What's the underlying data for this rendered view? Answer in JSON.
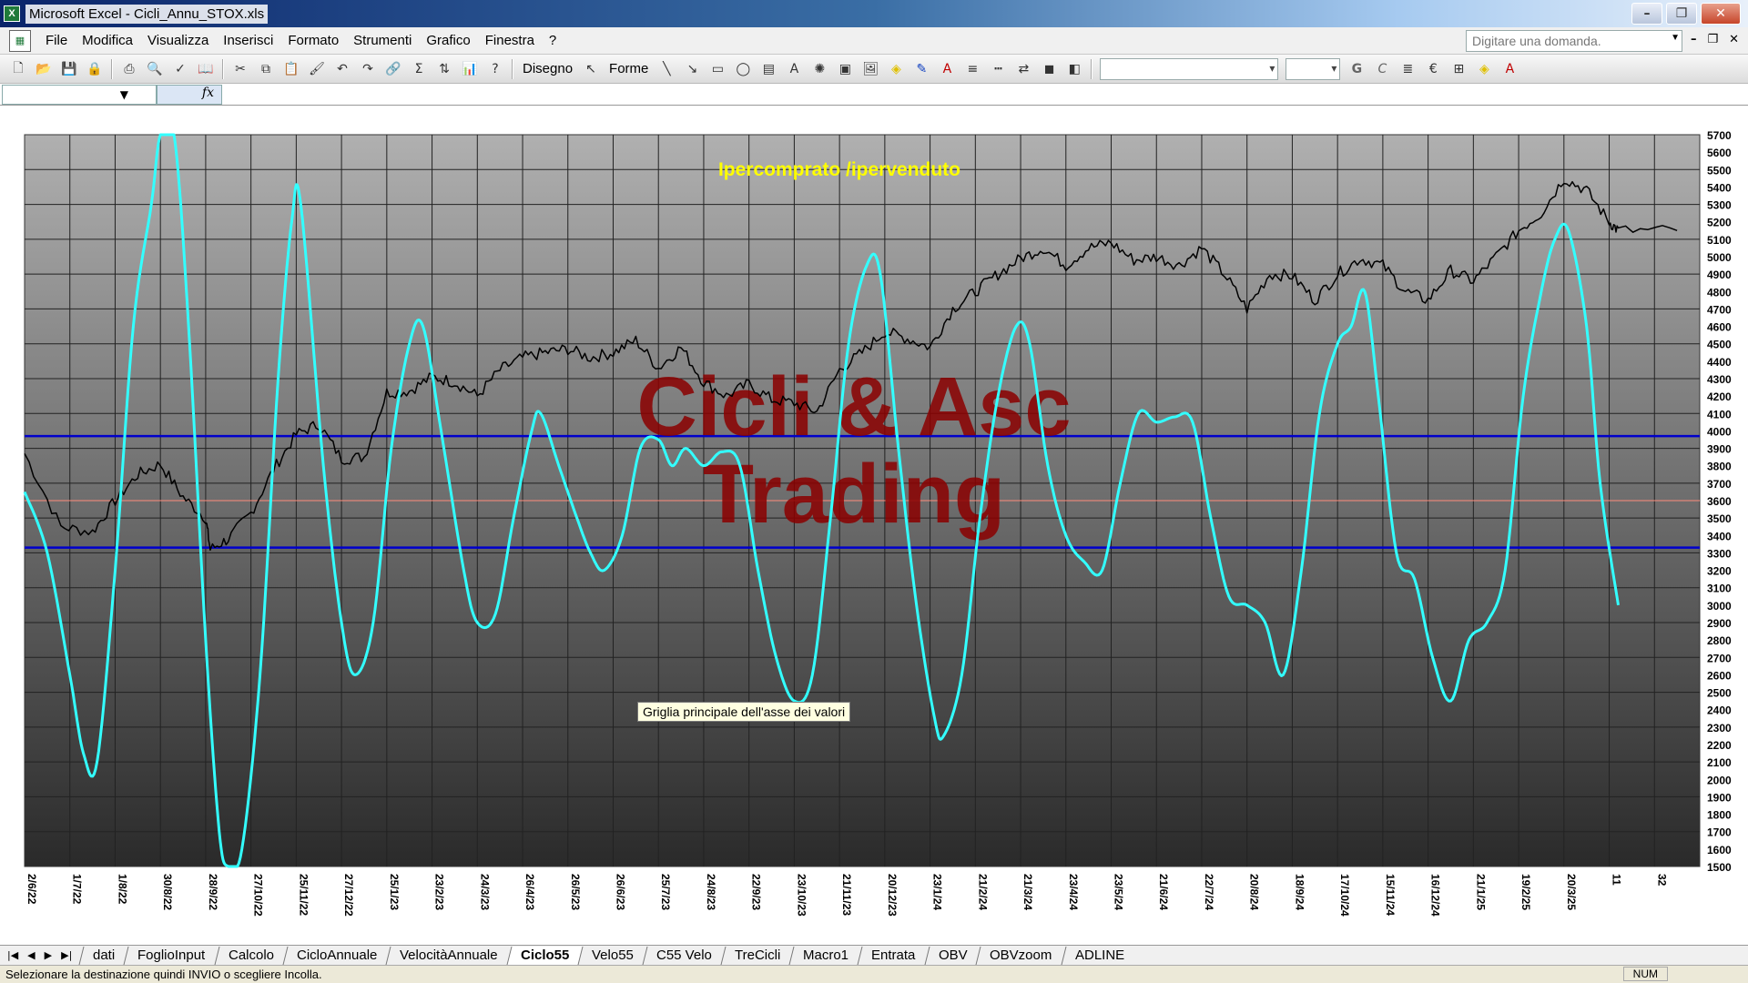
{
  "window": {
    "title": "Microsoft Excel - Cicli_Annu_STOX.xls"
  },
  "menu": {
    "items": [
      "File",
      "Modifica",
      "Visualizza",
      "Inserisci",
      "Formato",
      "Strumenti",
      "Grafico",
      "Finestra",
      "?"
    ],
    "ask_placeholder": "Digitare una domanda."
  },
  "toolbar": {
    "draw_label": "Disegno",
    "shapes_label": "Forme",
    "bold_label": "G",
    "italic_label": "C",
    "currency_label": "€"
  },
  "formula": {
    "fx_label": "fx"
  },
  "chart": {
    "watermark_line1": "Cicli & Asc",
    "watermark_line2": "Trading",
    "overlay_label": "Ipercomprato /ipervenduto",
    "tooltip": "Griglia principale dell'asse dei valori",
    "colors": {
      "plot_top": "#b0b0b0",
      "plot_bottom": "#2a2a2a",
      "price_line": "#000000",
      "oscillator": "#33ffff",
      "band_line": "#0000cc",
      "mid_line": "#ff8c7a",
      "watermark": "#8b0000",
      "overlay_label": "#ffff00"
    }
  },
  "chart_data": {
    "type": "line",
    "x_tick_labels": [
      "2/6/22",
      "1/7/22",
      "1/8/22",
      "30/8/22",
      "28/9/22",
      "27/10/22",
      "25/11/22",
      "27/12/22",
      "25/1/23",
      "23/2/23",
      "24/3/23",
      "26/4/23",
      "26/5/23",
      "26/6/23",
      "25/7/23",
      "24/8/23",
      "22/9/23",
      "23/10/23",
      "21/11/23",
      "20/12/23",
      "23/1/24",
      "21/2/24",
      "21/3/24",
      "23/4/24",
      "23/5/24",
      "21/6/24",
      "22/7/24",
      "20/8/24",
      "18/9/24",
      "17/10/24",
      "15/11/24",
      "16/12/24",
      "21/1/25",
      "19/2/25",
      "20/3/25",
      "11",
      "32"
    ],
    "y_ticks": [
      1500,
      1600,
      1700,
      1800,
      1900,
      2000,
      2100,
      2200,
      2300,
      2400,
      2500,
      2600,
      2700,
      2800,
      2900,
      3000,
      3100,
      3200,
      3300,
      3400,
      3500,
      3600,
      3700,
      3800,
      3900,
      4000,
      4100,
      4200,
      4300,
      4400,
      4500,
      4600,
      4700,
      4800,
      4900,
      5000,
      5100,
      5200,
      5300,
      5400,
      5500,
      5600,
      5700
    ],
    "ylim": [
      1500,
      5700
    ],
    "grid": true,
    "horizontal_lines": [
      {
        "name": "upper-band",
        "y": 3970
      },
      {
        "name": "mid-line",
        "y": 3600
      },
      {
        "name": "lower-band",
        "y": 3330
      }
    ],
    "series": [
      {
        "key": "price",
        "points": [
          [
            0,
            3870
          ],
          [
            0.8,
            3450
          ],
          [
            1.5,
            3420
          ],
          [
            2,
            3600
          ],
          [
            2.5,
            3750
          ],
          [
            3,
            3810
          ],
          [
            3.5,
            3620
          ],
          [
            4,
            3500
          ],
          [
            4.1,
            3320
          ],
          [
            4.5,
            3380
          ],
          [
            5,
            3530
          ],
          [
            5.5,
            3780
          ],
          [
            6,
            3980
          ],
          [
            6.5,
            4040
          ],
          [
            7,
            3840
          ],
          [
            7.5,
            3850
          ],
          [
            8,
            4220
          ],
          [
            8.5,
            4230
          ],
          [
            9,
            4310
          ],
          [
            9.5,
            4280
          ],
          [
            10,
            4200
          ],
          [
            10.5,
            4350
          ],
          [
            11,
            4420
          ],
          [
            11.5,
            4450
          ],
          [
            12,
            4470
          ],
          [
            12.5,
            4420
          ],
          [
            13,
            4450
          ],
          [
            13.5,
            4520
          ],
          [
            14,
            4360
          ],
          [
            14.5,
            4480
          ],
          [
            15,
            4280
          ],
          [
            15.5,
            4200
          ],
          [
            16,
            4270
          ],
          [
            16.5,
            4180
          ],
          [
            17,
            4160
          ],
          [
            17.5,
            4110
          ],
          [
            18,
            4350
          ],
          [
            18.5,
            4450
          ],
          [
            19,
            4570
          ],
          [
            19.5,
            4530
          ],
          [
            20,
            4480
          ],
          [
            20.5,
            4700
          ],
          [
            21,
            4800
          ],
          [
            21.5,
            4900
          ],
          [
            22,
            4990
          ],
          [
            22.5,
            5050
          ],
          [
            23,
            4950
          ],
          [
            23.5,
            5050
          ],
          [
            24,
            5080
          ],
          [
            24.5,
            4980
          ],
          [
            25,
            5000
          ],
          [
            25.5,
            4950
          ],
          [
            26,
            5050
          ],
          [
            26.5,
            4900
          ],
          [
            27,
            4700
          ],
          [
            27.5,
            4900
          ],
          [
            28,
            4890
          ],
          [
            28.5,
            4750
          ],
          [
            29,
            4900
          ],
          [
            29.5,
            4990
          ],
          [
            30,
            4950
          ],
          [
            30.5,
            4800
          ],
          [
            31,
            4750
          ],
          [
            31.5,
            4920
          ],
          [
            32,
            4860
          ],
          [
            32.5,
            5000
          ],
          [
            33,
            5150
          ],
          [
            33.5,
            5250
          ],
          [
            34,
            5450
          ],
          [
            34.5,
            5380
          ],
          [
            35,
            5200
          ],
          [
            35.2,
            5150
          ],
          [
            36.5,
            5150
          ]
        ]
      },
      {
        "key": "oscillator",
        "points": [
          [
            0,
            3650
          ],
          [
            0.5,
            3300
          ],
          [
            1,
            2600
          ],
          [
            1.3,
            2150
          ],
          [
            1.6,
            2100
          ],
          [
            2,
            3200
          ],
          [
            2.4,
            4600
          ],
          [
            2.8,
            5300
          ],
          [
            3,
            5700
          ],
          [
            3.3,
            5700
          ],
          [
            3.6,
            4700
          ],
          [
            4,
            2800
          ],
          [
            4.3,
            1700
          ],
          [
            4.5,
            1500
          ],
          [
            4.8,
            1600
          ],
          [
            5.2,
            2600
          ],
          [
            5.6,
            4300
          ],
          [
            5.9,
            5200
          ],
          [
            6.1,
            5300
          ],
          [
            6.6,
            3800
          ],
          [
            7,
            2900
          ],
          [
            7.3,
            2600
          ],
          [
            7.7,
            2900
          ],
          [
            8.1,
            3900
          ],
          [
            8.5,
            4500
          ],
          [
            8.8,
            4600
          ],
          [
            9.2,
            4000
          ],
          [
            9.7,
            3200
          ],
          [
            10,
            2900
          ],
          [
            10.4,
            2950
          ],
          [
            10.8,
            3500
          ],
          [
            11.2,
            4000
          ],
          [
            11.4,
            4100
          ],
          [
            11.8,
            3800
          ],
          [
            12.2,
            3500
          ],
          [
            12.5,
            3300
          ],
          [
            12.8,
            3200
          ],
          [
            13.2,
            3400
          ],
          [
            13.6,
            3900
          ],
          [
            14,
            3950
          ],
          [
            14.3,
            3800
          ],
          [
            14.6,
            3900
          ],
          [
            15,
            3800
          ],
          [
            15.4,
            3880
          ],
          [
            15.8,
            3800
          ],
          [
            16.2,
            3200
          ],
          [
            16.6,
            2700
          ],
          [
            17,
            2450
          ],
          [
            17.4,
            2600
          ],
          [
            17.8,
            3500
          ],
          [
            18.2,
            4500
          ],
          [
            18.6,
            4950
          ],
          [
            18.9,
            4900
          ],
          [
            19.3,
            3900
          ],
          [
            19.7,
            3000
          ],
          [
            20.1,
            2350
          ],
          [
            20.3,
            2250
          ],
          [
            20.7,
            2600
          ],
          [
            21.1,
            3500
          ],
          [
            21.5,
            4200
          ],
          [
            21.9,
            4600
          ],
          [
            22.2,
            4500
          ],
          [
            22.6,
            3800
          ],
          [
            23,
            3400
          ],
          [
            23.4,
            3250
          ],
          [
            23.8,
            3200
          ],
          [
            24.2,
            3700
          ],
          [
            24.6,
            4100
          ],
          [
            25,
            4050
          ],
          [
            25.4,
            4080
          ],
          [
            25.8,
            4050
          ],
          [
            26.2,
            3500
          ],
          [
            26.6,
            3050
          ],
          [
            27,
            3000
          ],
          [
            27.4,
            2900
          ],
          [
            27.8,
            2600
          ],
          [
            28.2,
            3200
          ],
          [
            28.6,
            4100
          ],
          [
            29,
            4500
          ],
          [
            29.3,
            4600
          ],
          [
            29.6,
            4800
          ],
          [
            29.9,
            4200
          ],
          [
            30.3,
            3300
          ],
          [
            30.7,
            3150
          ],
          [
            31.1,
            2700
          ],
          [
            31.5,
            2450
          ],
          [
            31.9,
            2800
          ],
          [
            32.3,
            2900
          ],
          [
            32.7,
            3200
          ],
          [
            33.1,
            4200
          ],
          [
            33.5,
            4800
          ],
          [
            33.8,
            5100
          ],
          [
            34.1,
            5150
          ],
          [
            34.5,
            4600
          ],
          [
            34.8,
            3700
          ],
          [
            35.2,
            3000
          ]
        ]
      }
    ]
  },
  "sheets": {
    "tabs": [
      "dati",
      "FoglioInput",
      "Calcolo",
      "CicloAnnuale",
      "VelocitàAnnuale",
      "Ciclo55",
      "Velo55",
      "C55 Velo",
      "TreCicli",
      "Macro1",
      "Entrata",
      "OBV",
      "OBVzoom",
      "ADLINE"
    ],
    "active": "Ciclo55"
  },
  "status": {
    "message": "Selezionare la destinazione quindi INVIO o scegliere Incolla.",
    "num_indicator": "NUM"
  }
}
